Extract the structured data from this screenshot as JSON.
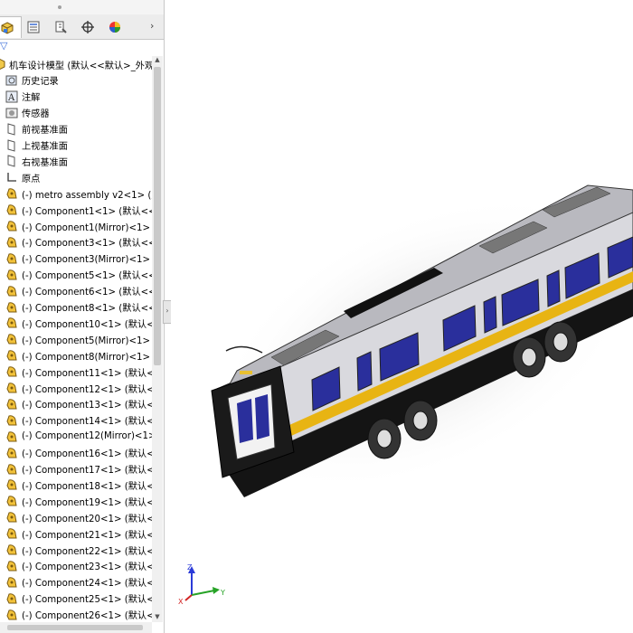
{
  "tabs": [
    {
      "name": "feature-manager-icon"
    },
    {
      "name": "property-manager-icon"
    },
    {
      "name": "configuration-manager-icon"
    },
    {
      "name": "dimxpert-icon"
    },
    {
      "name": "display-manager-icon"
    }
  ],
  "tabs_more": "›",
  "filter_glyph": "▽",
  "tree": {
    "root_label": "机车设计模型  (默认<<默认>_外观 显",
    "fixed_items": [
      {
        "label": "历史记录",
        "icon": "history-icon"
      },
      {
        "label": "注解",
        "icon": "annotations-icon"
      },
      {
        "label": "传感器",
        "icon": "sensors-icon"
      },
      {
        "label": "前视基准面",
        "icon": "plane-icon"
      },
      {
        "label": "上视基准面",
        "icon": "plane-icon"
      },
      {
        "label": "右视基准面",
        "icon": "plane-icon"
      },
      {
        "label": "原点",
        "icon": "origin-icon"
      }
    ],
    "components": [
      "(-) metro assembly v2<1>  (默认",
      "(-) Component1<1>  (默认<<默",
      "(-) Component1(Mirror)<1>  (默",
      "(-) Component3<1>  (默认<<默",
      "(-) Component3(Mirror)<1>  (默",
      "(-) Component5<1>  (默认<<默",
      "(-) Component6<1>  (默认<<默",
      "(-) Component8<1>  (默认<<默",
      "(-) Component10<1>  (默认<<",
      "(-) Component5(Mirror)<1>  (默",
      "(-) Component8(Mirror)<1>  (默",
      "(-) Component11<1>  (默认<<",
      "(-) Component12<1>  (默认<<",
      "(-) Component13<1>  (默认<<",
      "(-) Component14<1>  (默认<<",
      "(-) Component12(Mirror)<1>",
      "(-) Component16<1>  (默认<<",
      "(-) Component17<1>  (默认<<",
      "(-) Component18<1>  (默认<<",
      "(-) Component19<1>  (默认<<",
      "(-) Component20<1>  (默认<<",
      "(-) Component21<1>  (默认<<",
      "(-) Component22<1>  (默认<<",
      "(-) Component23<1>  (默认<<",
      "(-) Component24<1>  (默认<<",
      "(-) Component25<1>  (默认<<",
      "(-) Component26<1>  (默认<<"
    ]
  },
  "triad": {
    "z": "Z",
    "y": "Y",
    "x": "X"
  },
  "colors": {
    "train_body": "#d9d9de",
    "train_roof": "#b9b9bf",
    "window": "#2a2f9c",
    "stripe": "#e8b413",
    "chassis": "#141414",
    "axis_z": "#2b3bd8",
    "axis_y": "#27a327",
    "axis_x": "#d22525"
  }
}
